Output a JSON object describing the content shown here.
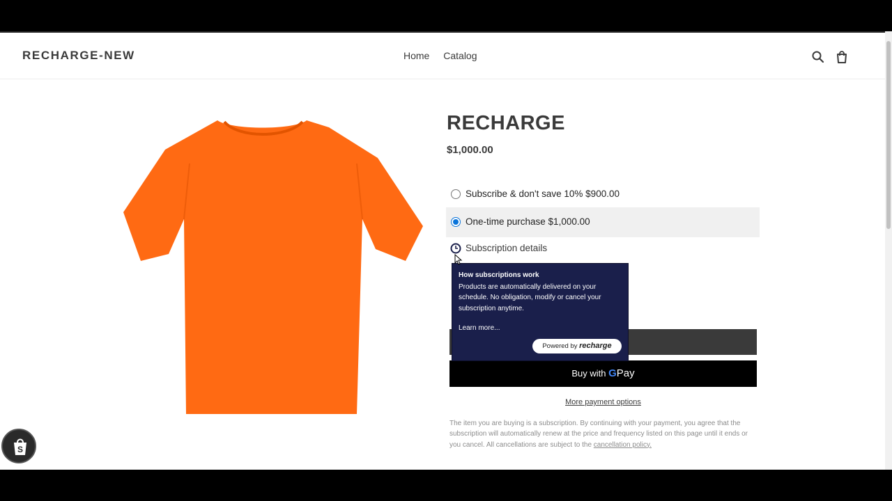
{
  "header": {
    "logo": "RECHARGE-NEW",
    "nav": [
      "Home",
      "Catalog"
    ],
    "icons": [
      "search-icon",
      "cart-icon"
    ]
  },
  "product": {
    "title": "RECHARGE",
    "price": "$1,000.00",
    "image_color": "#ff6a13",
    "options": {
      "subscribe": "Subscribe & don't save 10% $900.00",
      "one_time": "One-time purchase $1,000.00",
      "selected": "one_time"
    },
    "subscription_details": "Subscription details",
    "add_to_cart_visible": "T",
    "gpay_prefix": "Buy with",
    "gpay_brand": "Pay",
    "more_payment": "More payment options",
    "disclaimer": "The item you are buying is a subscription. By continuing with your payment, you agree that the subscription will automatically renew at the price and frequency listed on this page until it ends or you cancel. All cancellations are subject to the",
    "disclaimer_link": "cancellation policy."
  },
  "tooltip": {
    "title": "How subscriptions work",
    "body": "Products are automatically delivered on your schedule. No obligation, modify or cancel your subscription anytime.",
    "learn_more": "Learn more...",
    "powered_prefix": "Powered by",
    "powered_brand": "recharge"
  },
  "colors": {
    "tooltip_bg": "#1a1f4b",
    "accent_radio": "#0a74da",
    "button_dark": "#3a3a3a"
  }
}
